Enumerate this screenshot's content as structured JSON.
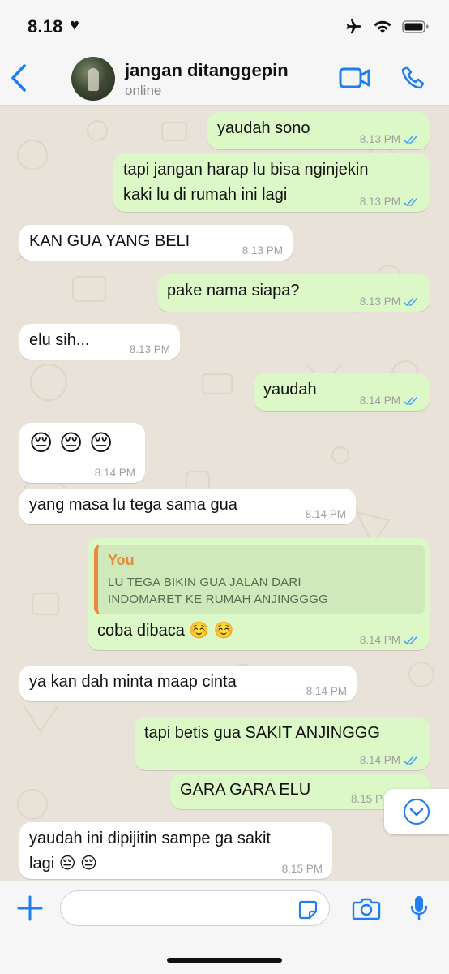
{
  "status_bar": {
    "time": "8.18",
    "heart": "♥"
  },
  "header": {
    "name": "jangan ditanggepin",
    "status": "online"
  },
  "messages": [
    {
      "text": "yaudah sono",
      "time": "8.13 PM"
    },
    {
      "line1": "tapi jangan harap lu bisa nginjekin",
      "line2": "kaki lu di rumah ini lagi",
      "time": "8.13 PM"
    },
    {
      "text": "KAN GUA YANG BELI",
      "time": "8.13 PM"
    },
    {
      "text": "pake nama siapa?",
      "time": "8.13 PM"
    },
    {
      "text": "elu sih...",
      "time": "8.13 PM"
    },
    {
      "text": "yaudah",
      "time": "8.14 PM"
    },
    {
      "text": "😔 😔 😔",
      "time": "8.14 PM"
    },
    {
      "text": "yang masa lu tega sama gua",
      "time": "8.14 PM"
    },
    {
      "quote_author": "You",
      "quote_line1": "LU TEGA BIKIN GUA JALAN DARI",
      "quote_line2": "INDOMARET KE RUMAH ANJINGGGG",
      "text": "coba dibaca ☺️ ☺️",
      "time": "8.14 PM"
    },
    {
      "text": "ya kan dah minta maap cinta",
      "time": "8.14 PM"
    },
    {
      "text": "tapi betis gua SAKIT ANJINGGG",
      "time": "8.14 PM"
    },
    {
      "text": "GARA GARA ELU",
      "time": "8.15 P"
    },
    {
      "line1": "yaudah ini dipijitin sampe ga sakit",
      "line2": "lagi 😔 😔",
      "time": "8.15 PM"
    }
  ],
  "input": {
    "placeholder": ""
  },
  "colors": {
    "accent": "#1f7ef0",
    "outgoing": "#dcf8c6",
    "incoming": "#ffffff",
    "quote_author": "#e8893c",
    "read_ticks": "#4fa3f7"
  }
}
